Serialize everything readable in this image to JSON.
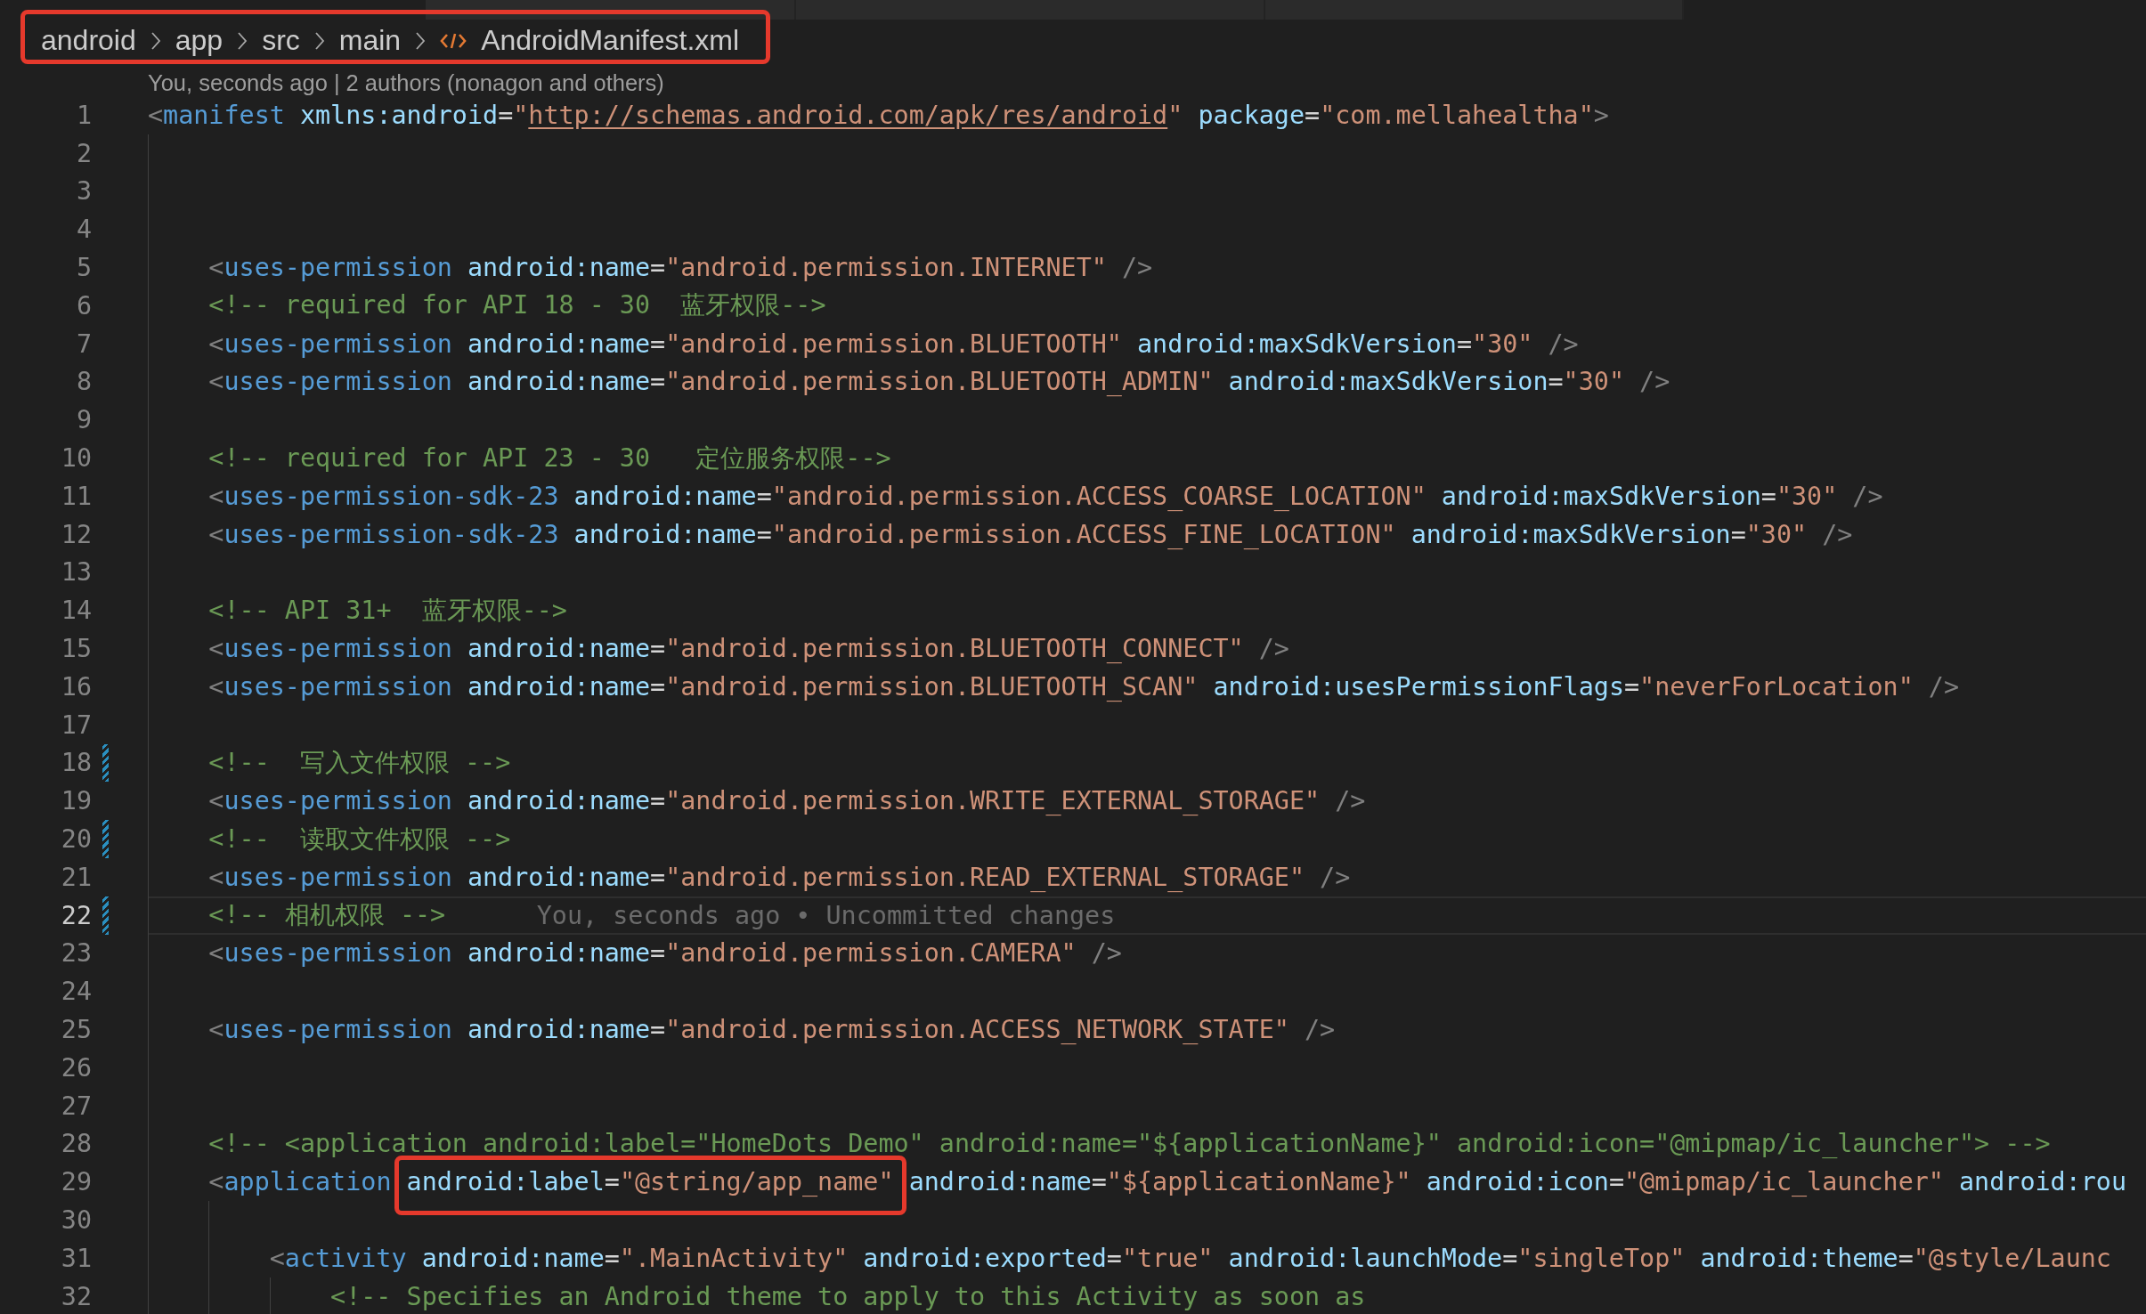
{
  "tabs": [
    {
      "selected": false
    },
    {
      "selected": false
    },
    {
      "selected": false
    }
  ],
  "breadcrumb": {
    "annotated": true,
    "items": [
      {
        "kind": "folder",
        "label": "android"
      },
      {
        "kind": "folder",
        "label": "app"
      },
      {
        "kind": "folder",
        "label": "src"
      },
      {
        "kind": "folder",
        "label": "main"
      },
      {
        "kind": "xml-file",
        "label": "AndroidManifest.xml"
      }
    ]
  },
  "editor": {
    "codelens": "You, seconds ago | 2 authors (nonagon and others)",
    "lines": [
      {
        "number": "1",
        "modified": false,
        "current": false,
        "tokens": [
          {
            "kind": "open",
            "text": "<"
          },
          {
            "kind": "tag",
            "text": "manifest"
          },
          {
            "kind": "attr",
            "text": "xmlns:android"
          },
          {
            "kind": "eq",
            "text": "="
          },
          {
            "kind": "quote",
            "text": "\""
          },
          {
            "kind": "link",
            "text": "http://schemas.android.com/apk/res/android"
          },
          {
            "kind": "quote",
            "text": "\""
          },
          {
            "kind": "attr",
            "text": "package"
          },
          {
            "kind": "eq",
            "text": "="
          },
          {
            "kind": "string",
            "text": "\"com.mellahealtha\""
          },
          {
            "kind": "end",
            "text": ">"
          }
        ],
        "children": [
          {
            "number": "2",
            "modified": false,
            "current": false
          },
          {
            "number": "3",
            "modified": false,
            "current": false
          },
          {
            "number": "4",
            "modified": false,
            "current": false
          },
          {
            "number": "5",
            "modified": false,
            "current": false,
            "tokens": [
              {
                "kind": "open",
                "text": "<"
              },
              {
                "kind": "tag",
                "text": "uses-permission"
              },
              {
                "kind": "attr",
                "text": "android:name"
              },
              {
                "kind": "eq",
                "text": "="
              },
              {
                "kind": "string",
                "text": "\"android.permission.INTERNET\""
              },
              {
                "kind": "selfclose",
                "text": "/>"
              }
            ]
          },
          {
            "number": "6",
            "modified": false,
            "current": false,
            "tokens": [
              {
                "kind": "comment",
                "text": "<!-- required for API 18 - 30  蓝牙权限-->"
              }
            ]
          },
          {
            "number": "7",
            "modified": false,
            "current": false,
            "tokens": [
              {
                "kind": "open",
                "text": "<"
              },
              {
                "kind": "tag",
                "text": "uses-permission"
              },
              {
                "kind": "attr",
                "text": "android:name"
              },
              {
                "kind": "eq",
                "text": "="
              },
              {
                "kind": "string",
                "text": "\"android.permission.BLUETOOTH\""
              },
              {
                "kind": "attr",
                "text": "android:maxSdkVersion"
              },
              {
                "kind": "eq",
                "text": "="
              },
              {
                "kind": "string",
                "text": "\"30\""
              },
              {
                "kind": "selfclose",
                "text": "/>"
              }
            ]
          },
          {
            "number": "8",
            "modified": false,
            "current": false,
            "tokens": [
              {
                "kind": "open",
                "text": "<"
              },
              {
                "kind": "tag",
                "text": "uses-permission"
              },
              {
                "kind": "attr",
                "text": "android:name"
              },
              {
                "kind": "eq",
                "text": "="
              },
              {
                "kind": "string",
                "text": "\"android.permission.BLUETOOTH_ADMIN\""
              },
              {
                "kind": "attr",
                "text": "android:maxSdkVersion"
              },
              {
                "kind": "eq",
                "text": "="
              },
              {
                "kind": "string",
                "text": "\"30\""
              },
              {
                "kind": "selfclose",
                "text": "/>"
              }
            ]
          },
          {
            "number": "9",
            "modified": false,
            "current": false
          },
          {
            "number": "10",
            "modified": false,
            "current": false,
            "tokens": [
              {
                "kind": "comment",
                "text": "<!-- required for API 23 - 30   定位服务权限-->"
              }
            ]
          },
          {
            "number": "11",
            "modified": false,
            "current": false,
            "tokens": [
              {
                "kind": "open",
                "text": "<"
              },
              {
                "kind": "tag",
                "text": "uses-permission-sdk-23"
              },
              {
                "kind": "attr",
                "text": "android:name"
              },
              {
                "kind": "eq",
                "text": "="
              },
              {
                "kind": "string",
                "text": "\"android.permission.ACCESS_COARSE_LOCATION\""
              },
              {
                "kind": "attr",
                "text": "android:maxSdkVersion"
              },
              {
                "kind": "eq",
                "text": "="
              },
              {
                "kind": "string",
                "text": "\"30\""
              },
              {
                "kind": "selfclose",
                "text": "/>"
              }
            ]
          },
          {
            "number": "12",
            "modified": false,
            "current": false,
            "tokens": [
              {
                "kind": "open",
                "text": "<"
              },
              {
                "kind": "tag",
                "text": "uses-permission-sdk-23"
              },
              {
                "kind": "attr",
                "text": "android:name"
              },
              {
                "kind": "eq",
                "text": "="
              },
              {
                "kind": "string",
                "text": "\"android.permission.ACCESS_FINE_LOCATION\""
              },
              {
                "kind": "attr",
                "text": "android:maxSdkVersion"
              },
              {
                "kind": "eq",
                "text": "="
              },
              {
                "kind": "string",
                "text": "\"30\""
              },
              {
                "kind": "selfclose",
                "text": "/>"
              }
            ]
          },
          {
            "number": "13",
            "modified": false,
            "current": false
          },
          {
            "number": "14",
            "modified": false,
            "current": false,
            "tokens": [
              {
                "kind": "comment",
                "text": "<!-- API 31+  蓝牙权限-->"
              }
            ]
          },
          {
            "number": "15",
            "modified": false,
            "current": false,
            "tokens": [
              {
                "kind": "open",
                "text": "<"
              },
              {
                "kind": "tag",
                "text": "uses-permission"
              },
              {
                "kind": "attr",
                "text": "android:name"
              },
              {
                "kind": "eq",
                "text": "="
              },
              {
                "kind": "string",
                "text": "\"android.permission.BLUETOOTH_CONNECT\""
              },
              {
                "kind": "selfclose",
                "text": "/>"
              }
            ]
          },
          {
            "number": "16",
            "modified": false,
            "current": false,
            "tokens": [
              {
                "kind": "open",
                "text": "<"
              },
              {
                "kind": "tag",
                "text": "uses-permission"
              },
              {
                "kind": "attr",
                "text": "android:name"
              },
              {
                "kind": "eq",
                "text": "="
              },
              {
                "kind": "string",
                "text": "\"android.permission.BLUETOOTH_SCAN\""
              },
              {
                "kind": "attr",
                "text": "android:usesPermissionFlags"
              },
              {
                "kind": "eq",
                "text": "="
              },
              {
                "kind": "string",
                "text": "\"neverForLocation\""
              },
              {
                "kind": "selfclose",
                "text": "/>"
              }
            ]
          },
          {
            "number": "17",
            "modified": false,
            "current": false
          },
          {
            "number": "18",
            "modified": true,
            "current": false,
            "tokens": [
              {
                "kind": "comment",
                "text": "<!--  写入文件权限 -->"
              }
            ]
          },
          {
            "number": "19",
            "modified": false,
            "current": false,
            "tokens": [
              {
                "kind": "open",
                "text": "<"
              },
              {
                "kind": "tag",
                "text": "uses-permission"
              },
              {
                "kind": "attr",
                "text": "android:name"
              },
              {
                "kind": "eq",
                "text": "="
              },
              {
                "kind": "string",
                "text": "\"android.permission.WRITE_EXTERNAL_STORAGE\""
              },
              {
                "kind": "selfclose",
                "text": "/>"
              }
            ]
          },
          {
            "number": "20",
            "modified": true,
            "current": false,
            "tokens": [
              {
                "kind": "comment",
                "text": "<!--  读取文件权限 -->"
              }
            ]
          },
          {
            "number": "21",
            "modified": false,
            "current": false,
            "tokens": [
              {
                "kind": "open",
                "text": "<"
              },
              {
                "kind": "tag",
                "text": "uses-permission"
              },
              {
                "kind": "attr",
                "text": "android:name"
              },
              {
                "kind": "eq",
                "text": "="
              },
              {
                "kind": "string",
                "text": "\"android.permission.READ_EXTERNAL_STORAGE\""
              },
              {
                "kind": "selfclose",
                "text": "/>"
              }
            ]
          },
          {
            "number": "22",
            "modified": true,
            "current": true,
            "blame": "You, seconds ago • Uncommitted changes",
            "tokens": [
              {
                "kind": "comment",
                "text": "<!-- 相机权限 -->"
              }
            ]
          },
          {
            "number": "23",
            "modified": false,
            "current": false,
            "tokens": [
              {
                "kind": "open",
                "text": "<"
              },
              {
                "kind": "tag",
                "text": "uses-permission"
              },
              {
                "kind": "attr",
                "text": "android:name"
              },
              {
                "kind": "eq",
                "text": "="
              },
              {
                "kind": "string",
                "text": "\"android.permission.CAMERA\""
              },
              {
                "kind": "selfclose",
                "text": "/>"
              }
            ]
          },
          {
            "number": "24",
            "modified": false,
            "current": false
          },
          {
            "number": "25",
            "modified": false,
            "current": false,
            "tokens": [
              {
                "kind": "open",
                "text": "<"
              },
              {
                "kind": "tag",
                "text": "uses-permission"
              },
              {
                "kind": "attr",
                "text": "android:name"
              },
              {
                "kind": "eq",
                "text": "="
              },
              {
                "kind": "string",
                "text": "\"android.permission.ACCESS_NETWORK_STATE\""
              },
              {
                "kind": "selfclose",
                "text": "/>"
              }
            ]
          },
          {
            "number": "26",
            "modified": false,
            "current": false
          },
          {
            "number": "27",
            "modified": false,
            "current": false
          },
          {
            "number": "28",
            "modified": false,
            "current": false,
            "tokens": [
              {
                "kind": "comment",
                "text": "<!-- <application android:label=\"HomeDots Demo\" android:name=\"${applicationName}\" android:icon=\"@mipmap/ic_launcher\"> -->"
              }
            ]
          },
          {
            "number": "29",
            "modified": false,
            "current": false,
            "tokens": [
              {
                "kind": "open",
                "text": "<"
              },
              {
                "kind": "tag",
                "text": "application"
              },
              {
                "kind": "callout",
                "tokens": [
                  {
                    "kind": "attr",
                    "text": "android:label"
                  },
                  {
                    "kind": "eq",
                    "text": "="
                  },
                  {
                    "kind": "string",
                    "text": "\"@string/app_name\""
                  }
                ]
              },
              {
                "kind": "attr",
                "text": "android:name"
              },
              {
                "kind": "eq",
                "text": "="
              },
              {
                "kind": "string",
                "text": "\"${applicationName}\""
              },
              {
                "kind": "attr",
                "text": "android:icon"
              },
              {
                "kind": "eq",
                "text": "="
              },
              {
                "kind": "string",
                "text": "\"@mipmap/ic_launcher\""
              },
              {
                "kind": "attr",
                "text": "android:rou"
              }
            ],
            "children": [
              {
                "number": "30",
                "modified": false,
                "current": false
              },
              {
                "number": "31",
                "modified": false,
                "current": false,
                "tokens": [
                  {
                    "kind": "open",
                    "text": "<"
                  },
                  {
                    "kind": "tag",
                    "text": "activity"
                  },
                  {
                    "kind": "attr",
                    "text": "android:name"
                  },
                  {
                    "kind": "eq",
                    "text": "="
                  },
                  {
                    "kind": "string",
                    "text": "\".MainActivity\""
                  },
                  {
                    "kind": "attr",
                    "text": "android:exported"
                  },
                  {
                    "kind": "eq",
                    "text": "="
                  },
                  {
                    "kind": "string",
                    "text": "\"true\""
                  },
                  {
                    "kind": "attr",
                    "text": "android:launchMode"
                  },
                  {
                    "kind": "eq",
                    "text": "="
                  },
                  {
                    "kind": "string",
                    "text": "\"singleTop\""
                  },
                  {
                    "kind": "attr",
                    "text": "android:theme"
                  },
                  {
                    "kind": "eq",
                    "text": "="
                  },
                  {
                    "kind": "string",
                    "text": "\"@style/Launc"
                  }
                ],
                "children": [
                  {
                    "number": "32",
                    "modified": false,
                    "current": false,
                    "tokens": [
                      {
                        "kind": "comment",
                        "text": "<!-- Specifies an Android theme to apply to this Activity as soon as"
                      }
                    ]
                  }
                ]
              }
            ]
          }
        ]
      }
    ]
  }
}
